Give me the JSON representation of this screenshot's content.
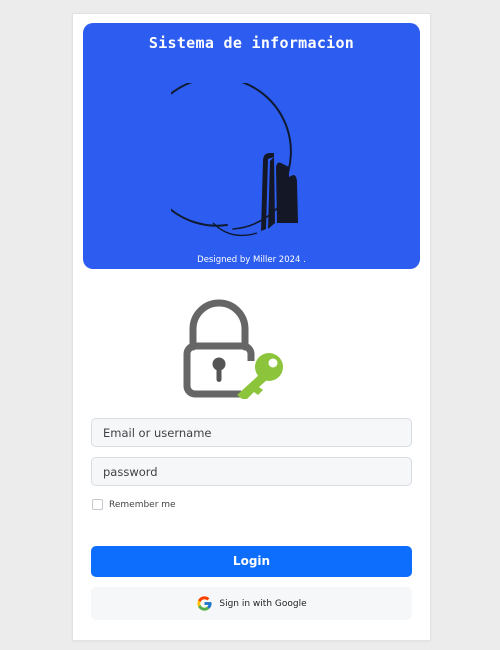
{
  "banner": {
    "title": "Sistema de informacion",
    "credit": "Designed by Miller 2024 .",
    "background_color": "#2c5cf0"
  },
  "icons": {
    "logo": "building-logo-icon",
    "lock": "lock-key-icon",
    "google": "google-icon"
  },
  "form": {
    "email_placeholder": "Email or username",
    "password_placeholder": "password",
    "remember_label": "Remember me",
    "remember_checked": false
  },
  "actions": {
    "login_label": "Login",
    "login_color": "#0d6efd",
    "google_label": "Sign in with Google"
  }
}
